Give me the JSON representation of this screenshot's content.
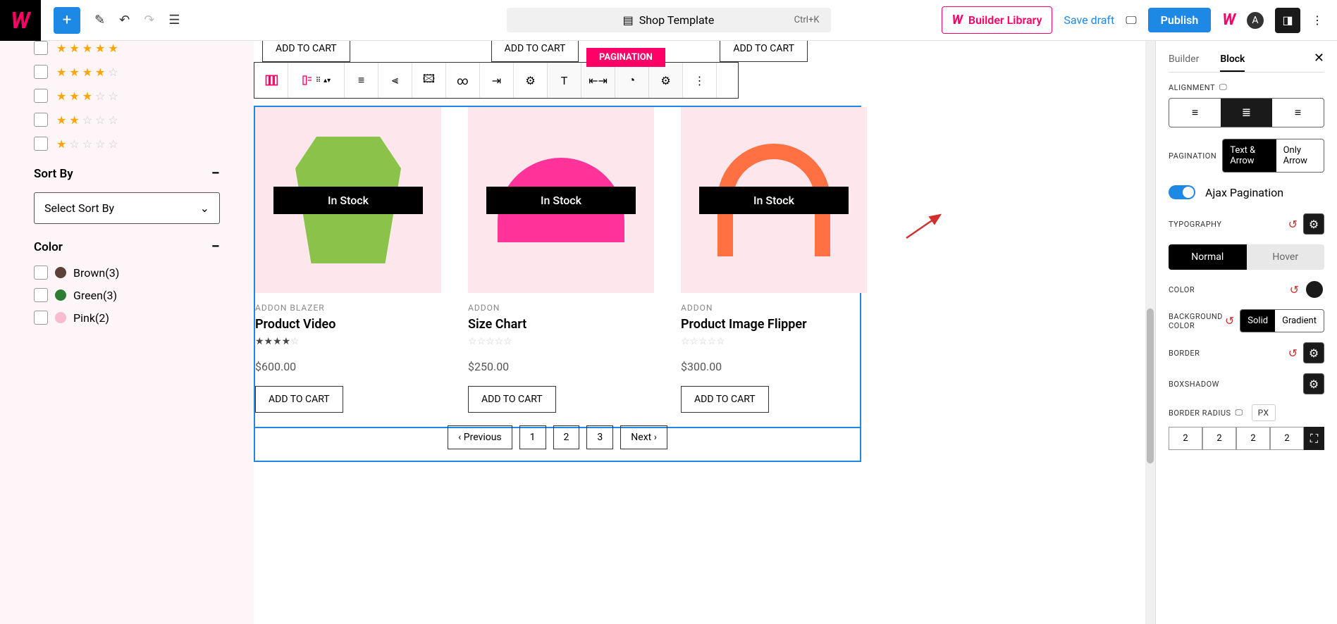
{
  "topbar": {
    "template_label": "Shop Template",
    "shortcut": "Ctrl+K",
    "builder_library": "Builder Library",
    "save_draft": "Save draft",
    "publish": "Publish"
  },
  "sidebar": {
    "ratings": [
      5,
      4,
      3,
      2,
      1
    ],
    "sort_title": "Sort By",
    "sort_placeholder": "Select Sort By",
    "color_title": "Color",
    "colors": [
      {
        "name": "Brown(3)",
        "hex": "#5d4037"
      },
      {
        "name": "Green(3)",
        "hex": "#2e7d32"
      },
      {
        "name": "Pink(2)",
        "hex": "#f8bbd0"
      }
    ]
  },
  "canvas": {
    "pagination_tag": "PAGINATION",
    "products": [
      {
        "stock": "In Stock",
        "category": "ADDON  BLAZER",
        "title": "Product Video",
        "rating": 4,
        "price": "$600.00",
        "btn": "ADD TO CART"
      },
      {
        "stock": "In Stock",
        "category": "ADDON",
        "title": "Size Chart",
        "rating": 0,
        "price": "$250.00",
        "btn": "ADD TO CART"
      },
      {
        "stock": "In Stock",
        "category": "ADDON",
        "title": "Product Image Flipper",
        "rating": 0,
        "price": "$300.00",
        "btn": "ADD TO CART"
      }
    ],
    "top_btns": [
      "ADD TO CART",
      "ADD TO CART",
      "ADD TO CART"
    ],
    "pagination": {
      "prev": "Previous",
      "pages": [
        "1",
        "2",
        "3"
      ],
      "next": "Next"
    }
  },
  "panel": {
    "tabs": {
      "builder": "Builder",
      "block": "Block"
    },
    "alignment": "ALIGNMENT",
    "pagination_label": "PAGINATION",
    "pag_options": {
      "text_arrow": "Text & Arrow",
      "only_arrow": "Only Arrow"
    },
    "ajax": "Ajax Pagination",
    "typography": "TYPOGRAPHY",
    "normal": "Normal",
    "hover": "Hover",
    "color": "COLOR",
    "bg_color": "BACKGROUND COLOR",
    "solid": "Solid",
    "gradient": "Gradient",
    "border": "BORDER",
    "boxshadow": "BOXSHADOW",
    "border_radius": "BORDER RADIUS",
    "px": "px",
    "radius_values": [
      "2",
      "2",
      "2",
      "2"
    ]
  }
}
